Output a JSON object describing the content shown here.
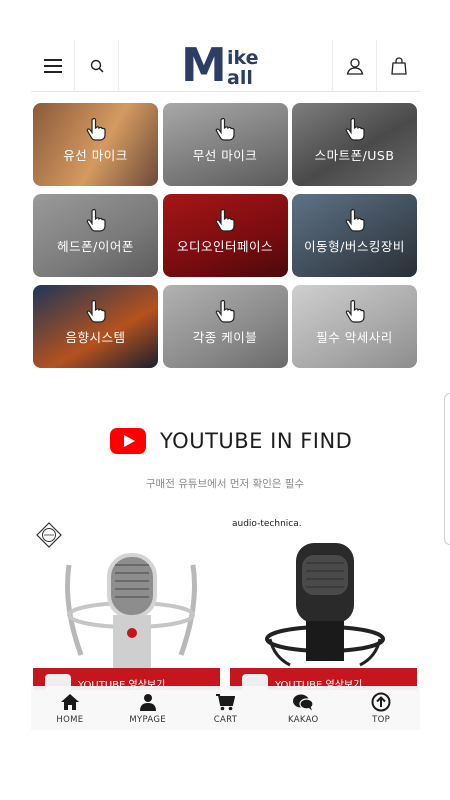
{
  "header": {
    "logo_big": "M",
    "logo_line1": "ike",
    "logo_line2": "all",
    "menu_icon": "hamburger-icon",
    "search_icon": "search-icon",
    "account_icon": "user-icon",
    "cart_icon": "shopping-bag-icon"
  },
  "categories": [
    {
      "label": "유선 마이크"
    },
    {
      "label": "무선 마이크"
    },
    {
      "label": "스마트폰/USB"
    },
    {
      "label": "헤드폰/이어폰"
    },
    {
      "label": "오디오인터페이스"
    },
    {
      "label": "이동형/버스킹장비"
    },
    {
      "label": "음향시스템"
    },
    {
      "label": "각종 케이블"
    },
    {
      "label": "필수 악세사리"
    }
  ],
  "youtube": {
    "title": "YOUTUBE IN FIND",
    "subtitle": "구매전 유튜브에서 먼저 확인은 필수",
    "cards": [
      {
        "brand": "",
        "bar_text": "YOUTUBE 영상보기"
      },
      {
        "brand": "audio-technica.",
        "bar_text": "YOUTUBE 영상보기"
      }
    ]
  },
  "bottom_nav": [
    {
      "label": "HOME",
      "icon": "home-icon"
    },
    {
      "label": "MYPAGE",
      "icon": "person-icon"
    },
    {
      "label": "CART",
      "icon": "cart-icon"
    },
    {
      "label": "KAKAO",
      "icon": "chat-bubble-icon"
    },
    {
      "label": "TOP",
      "icon": "arrow-up-circle-icon"
    }
  ],
  "colors": {
    "brand": "#2c3e63",
    "youtube_red": "#ff0000",
    "card_bar": "#c4161c"
  }
}
